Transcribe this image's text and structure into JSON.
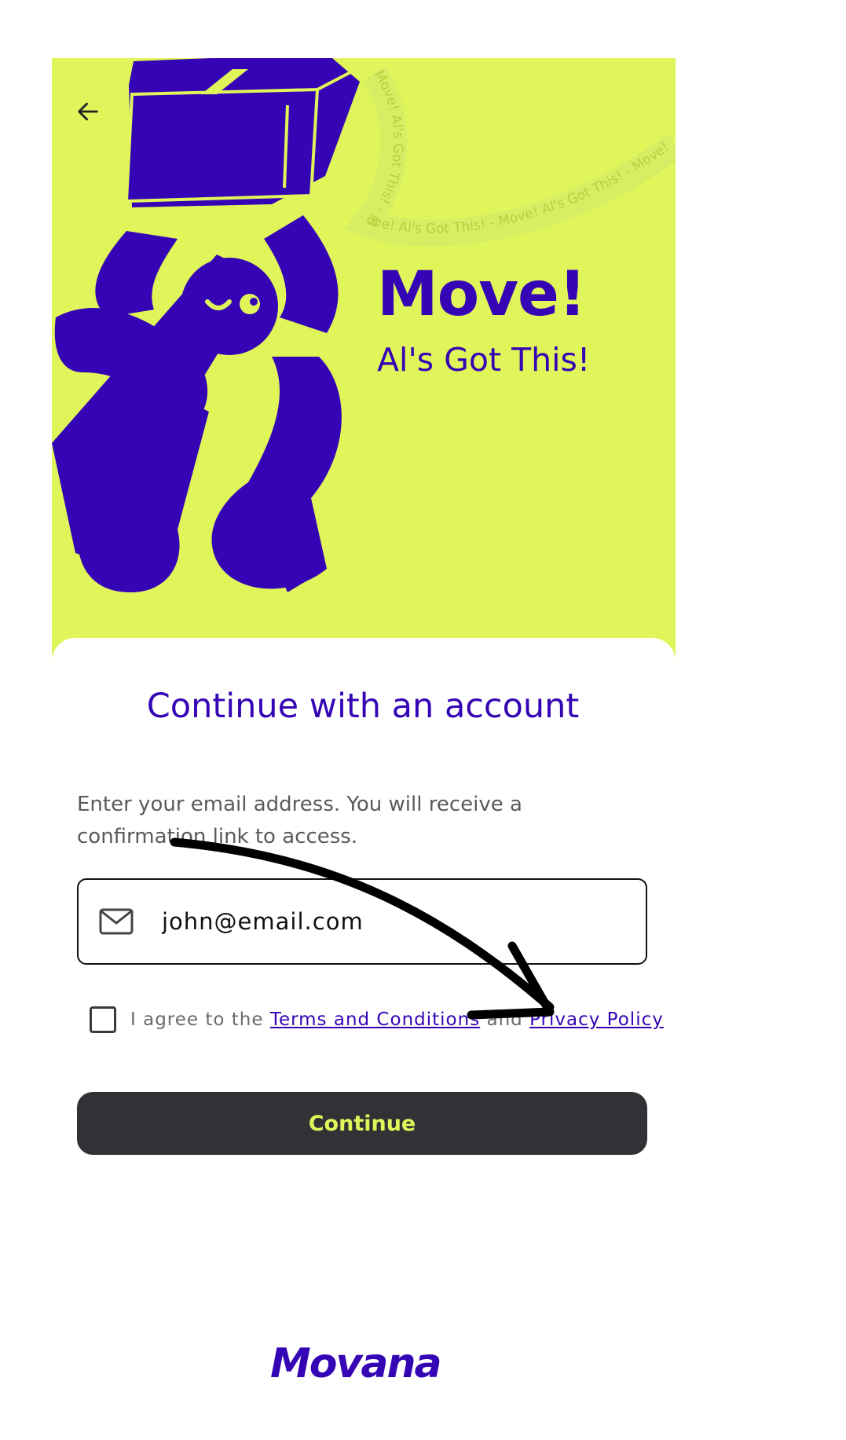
{
  "hero": {
    "title": "Move!",
    "subtitle": "Al's Got This!",
    "ribbon_text": "Move! Al's Got This! - Move! Al's Got This! - Move! Al's Got This! - Move! Al's Got This! -",
    "background_color": "#e0f55a",
    "accent_color": "#3505b5",
    "back_icon": "arrow-left-icon"
  },
  "form": {
    "title": "Continue with an account",
    "instruction": "Enter your email address. You will receive a confirmation link to access.",
    "email_value": "john@email.com",
    "email_icon": "mail-icon",
    "consent_prefix": "I agree to the ",
    "terms_link": "Terms and Conditions",
    "consent_and": " and ",
    "privacy_link": "Privacy Policy",
    "consent_checked": false,
    "continue_label": "Continue",
    "button_color": "#323135"
  },
  "footer": {
    "logo_text": "Movana"
  }
}
